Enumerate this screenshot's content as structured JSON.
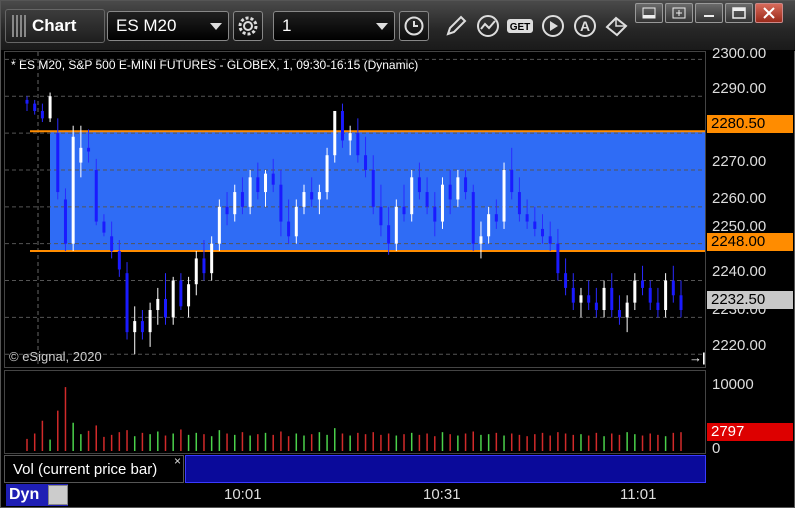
{
  "window": {
    "title": "Chart",
    "symbol": "ES M20",
    "interval": "1"
  },
  "toolbar": {
    "buttons": [
      "gear-icon",
      "clock-icon",
      "pencil-icon",
      "indicator-icon",
      "get-icon",
      "play-icon",
      "a-icon",
      "cursor-icon"
    ],
    "get_label": "GET",
    "a_label": "A"
  },
  "chart": {
    "legend": "* ES M20, S&P 500 E-MINI FUTURES - GLOBEX, 1, 09:30-16:15 (Dynamic)",
    "copyright": "© eSignal, 2020",
    "price_ticks": [
      "2300.00",
      "2290.00",
      "2270.00",
      "2260.00",
      "2250.00",
      "2240.00",
      "2230.00",
      "2220.00"
    ],
    "upper_level": "2280.50",
    "lower_level": "2248.00",
    "last_price": "2232.50",
    "volume_ticks": [
      "10000",
      "0"
    ],
    "last_volume": "2797",
    "volume_legend": "Vol (current price bar)",
    "time_ticks": [
      "10:01",
      "10:31",
      "11:01"
    ],
    "mode": "Dyn",
    "colors": {
      "zone": "#2f6cf5",
      "level": "#ff8c00",
      "up_candle": "#ffffff",
      "down_candle": "#1a1aff",
      "vol_up": "#4bd24b",
      "vol_down": "#d22a2a"
    }
  },
  "chart_data": {
    "type": "candlestick",
    "ylim": [
      2216,
      2302
    ],
    "levels": [
      2280.5,
      2248.0
    ],
    "series": [
      {
        "ohlc": [
          [
            2289,
            2290,
            2286,
            2288
          ],
          [
            2288,
            2289,
            2285,
            2286
          ],
          [
            2286,
            2288,
            2283,
            2284
          ],
          [
            2284,
            2291,
            2283,
            2290
          ],
          [
            2280,
            2284,
            2262,
            2264
          ],
          [
            2262,
            2265,
            2248,
            2250
          ],
          [
            2250,
            2282,
            2248,
            2279
          ],
          [
            2272,
            2282,
            2268,
            2276
          ],
          [
            2276,
            2281,
            2272,
            2275
          ],
          [
            2270,
            2273,
            2255,
            2256
          ],
          [
            2256,
            2258,
            2252,
            2253
          ],
          [
            2252,
            2256,
            2246,
            2248
          ],
          [
            2248,
            2251,
            2241,
            2243
          ],
          [
            2242,
            2245,
            2224,
            2226
          ],
          [
            2226,
            2233,
            2220,
            2229
          ],
          [
            2229,
            2232,
            2224,
            2226
          ],
          [
            2226,
            2234,
            2222,
            2232
          ],
          [
            2232,
            2238,
            2228,
            2235
          ],
          [
            2235,
            2242,
            2228,
            2230
          ],
          [
            2230,
            2241,
            2228,
            2240
          ],
          [
            2240,
            2242,
            2232,
            2233
          ],
          [
            2233,
            2241,
            2230,
            2239
          ],
          [
            2239,
            2248,
            2236,
            2246
          ],
          [
            2246,
            2251,
            2240,
            2242
          ],
          [
            2242,
            2252,
            2240,
            2250
          ],
          [
            2250,
            2262,
            2248,
            2260
          ],
          [
            2260,
            2264,
            2255,
            2258
          ],
          [
            2258,
            2266,
            2256,
            2264
          ],
          [
            2264,
            2268,
            2258,
            2260
          ],
          [
            2260,
            2270,
            2258,
            2268
          ],
          [
            2268,
            2272,
            2262,
            2264
          ],
          [
            2264,
            2270,
            2260,
            2269
          ],
          [
            2269,
            2273,
            2264,
            2266
          ],
          [
            2266,
            2270,
            2252,
            2256
          ],
          [
            2256,
            2262,
            2250,
            2252
          ],
          [
            2252,
            2262,
            2250,
            2260
          ],
          [
            2260,
            2266,
            2258,
            2264
          ],
          [
            2264,
            2268,
            2260,
            2262
          ],
          [
            2262,
            2266,
            2258,
            2264
          ],
          [
            2264,
            2276,
            2262,
            2274
          ],
          [
            2274,
            2286,
            2272,
            2286
          ],
          [
            2286,
            2288,
            2276,
            2278
          ],
          [
            2278,
            2282,
            2274,
            2280
          ],
          [
            2280,
            2284,
            2272,
            2274
          ],
          [
            2274,
            2279,
            2268,
            2270
          ],
          [
            2270,
            2274,
            2258,
            2260
          ],
          [
            2260,
            2266,
            2252,
            2255
          ],
          [
            2255,
            2260,
            2247,
            2250
          ],
          [
            2250,
            2262,
            2248,
            2260
          ],
          [
            2260,
            2266,
            2256,
            2258
          ],
          [
            2258,
            2270,
            2256,
            2268
          ],
          [
            2268,
            2272,
            2262,
            2264
          ],
          [
            2264,
            2268,
            2258,
            2260
          ],
          [
            2260,
            2264,
            2252,
            2256
          ],
          [
            2256,
            2268,
            2254,
            2266
          ],
          [
            2266,
            2270,
            2258,
            2262
          ],
          [
            2262,
            2270,
            2260,
            2268
          ],
          [
            2268,
            2270,
            2262,
            2264
          ],
          [
            2264,
            2266,
            2248,
            2250
          ],
          [
            2250,
            2256,
            2246,
            2252
          ],
          [
            2252,
            2260,
            2250,
            2258
          ],
          [
            2258,
            2262,
            2254,
            2256
          ],
          [
            2256,
            2272,
            2254,
            2270
          ],
          [
            2270,
            2276,
            2262,
            2264
          ],
          [
            2264,
            2268,
            2256,
            2258
          ],
          [
            2258,
            2262,
            2254,
            2256
          ],
          [
            2256,
            2260,
            2252,
            2254
          ],
          [
            2254,
            2258,
            2250,
            2252
          ],
          [
            2252,
            2256,
            2248,
            2250
          ],
          [
            2250,
            2254,
            2240,
            2242
          ],
          [
            2242,
            2246,
            2236,
            2238
          ],
          [
            2238,
            2242,
            2232,
            2234
          ],
          [
            2234,
            2238,
            2230,
            2236
          ],
          [
            2236,
            2240,
            2232,
            2234
          ],
          [
            2234,
            2238,
            2230,
            2232
          ],
          [
            2232,
            2240,
            2230,
            2238
          ],
          [
            2238,
            2242,
            2230,
            2232
          ],
          [
            2232,
            2236,
            2228,
            2230
          ],
          [
            2230,
            2236,
            2226,
            2234
          ],
          [
            2234,
            2242,
            2232,
            2240
          ],
          [
            2240,
            2244,
            2236,
            2238
          ],
          [
            2238,
            2240,
            2232,
            2234
          ],
          [
            2234,
            2238,
            2230,
            2232
          ],
          [
            2232,
            2242,
            2230,
            2240
          ],
          [
            2240,
            2244,
            2234,
            2236
          ],
          [
            2236,
            2240,
            2230,
            2232
          ]
        ],
        "volume": [
          1800,
          2600,
          4500,
          1700,
          6000,
          9500,
          4200,
          2500,
          3000,
          3800,
          2100,
          2400,
          2800,
          3100,
          2200,
          2700,
          2500,
          2900,
          2300,
          2600,
          3200,
          2400,
          2700,
          2500,
          2200,
          3100,
          2600,
          2400,
          2800,
          2300,
          2500,
          2700,
          2400,
          2900,
          2200,
          2600,
          2300,
          2500,
          2800,
          2400,
          3400,
          2600,
          2300,
          2700,
          2500,
          2800,
          2400,
          2600,
          2300,
          2500,
          2700,
          2400,
          2600,
          2200,
          2800,
          2500,
          2300,
          2600,
          2900,
          2400,
          2500,
          2700,
          2300,
          2600,
          2400,
          2200,
          2500,
          2700,
          2300,
          2800,
          2600,
          2400,
          2500,
          2300,
          2700,
          2200,
          2600,
          2400,
          2800,
          2500,
          2300,
          2600,
          2400,
          2200,
          2700,
          2797
        ]
      }
    ]
  }
}
